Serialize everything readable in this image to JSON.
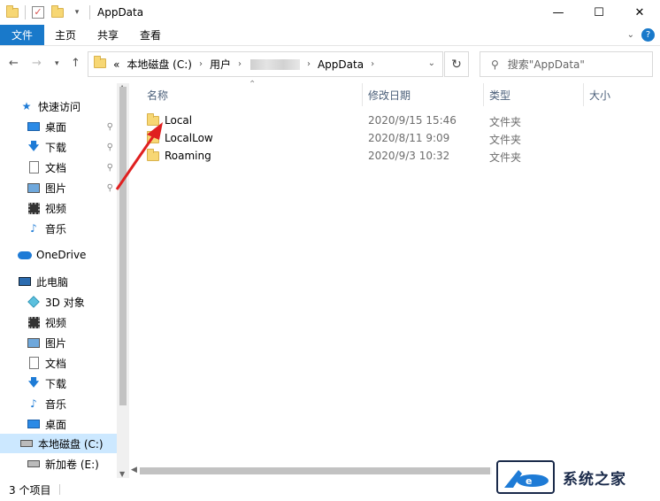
{
  "window": {
    "title": "AppData",
    "controls": {
      "minimize": "—",
      "maximize": "☐",
      "close": "✕"
    }
  },
  "ribbon": {
    "tabs": [
      "文件",
      "主页",
      "共享",
      "查看"
    ]
  },
  "address": {
    "overflow": "«",
    "crumbs": [
      "本地磁盘 (C:)",
      "用户",
      "AppData"
    ],
    "search_placeholder": "搜索\"AppData\""
  },
  "nav": {
    "quick_access": "快速访问",
    "quick_items": [
      "桌面",
      "下载",
      "文档",
      "图片",
      "视频",
      "音乐"
    ],
    "onedrive": "OneDrive",
    "this_pc": "此电脑",
    "pc_items": [
      "3D 对象",
      "视频",
      "图片",
      "文档",
      "下载",
      "音乐",
      "桌面",
      "本地磁盘 (C:)",
      "新加卷 (E:)"
    ]
  },
  "columns": [
    "名称",
    "修改日期",
    "类型",
    "大小"
  ],
  "files": [
    {
      "name": "Local",
      "date": "2020/9/15 15:46",
      "type": "文件夹"
    },
    {
      "name": "LocalLow",
      "date": "2020/8/11 9:09",
      "type": "文件夹"
    },
    {
      "name": "Roaming",
      "date": "2020/9/3 10:32",
      "type": "文件夹"
    }
  ],
  "status": {
    "count": "3 个项目"
  },
  "watermark": {
    "text": "系统之家"
  },
  "colors": {
    "accent": "#1979ca",
    "selected": "#cce8ff",
    "annotation_arrow": "#e02020"
  }
}
